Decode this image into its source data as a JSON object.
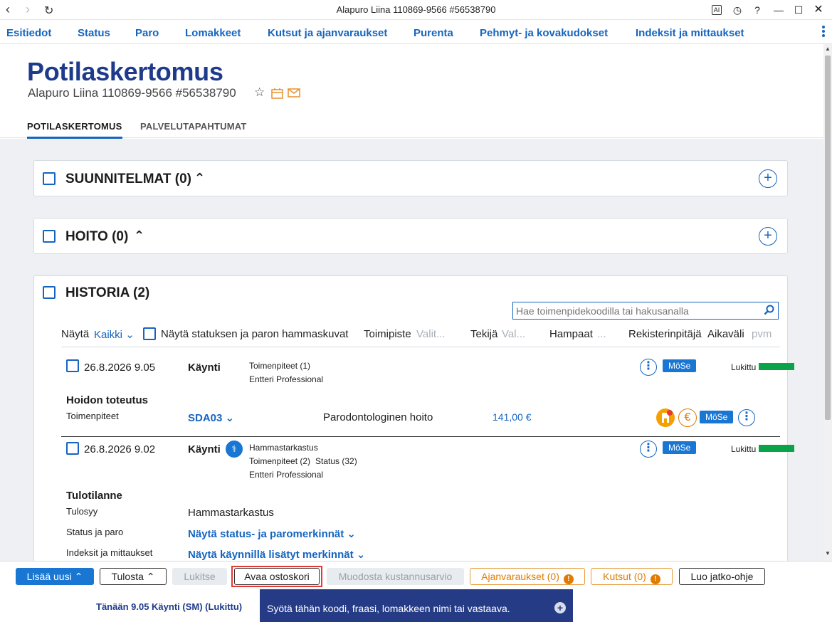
{
  "window": {
    "title": "Alapuro Liina 110869-9566 #56538790",
    "controls": [
      "AI",
      "history-icon",
      "?",
      "minimize",
      "maximize",
      "close"
    ]
  },
  "menu": {
    "items": [
      "Esitiedot",
      "Status",
      "Paro",
      "Lomakkeet",
      "Kutsut ja ajanvaraukset",
      "Purenta",
      "Pehmyt- ja kovakudokset",
      "Indeksit ja mittaukset"
    ]
  },
  "header": {
    "title": "Potilaskertomus",
    "patient": "Alapuro Liina 110869-9566 #56538790",
    "tabs": [
      "POTILASKERTOMUS",
      "PALVELUTAPAHTUMAT"
    ]
  },
  "panels": {
    "suunnitelmat": "SUUNNITELMAT (0)",
    "hoito": "HOITO (0)",
    "historia": "HISTORIA (2)"
  },
  "historia": {
    "search_placeholder": "Hae toimenpidekoodilla tai hakusanalla",
    "filters": {
      "show_label": "Näytä",
      "show_value": "Kaikki",
      "status_checkbox": "Näytä statuksen ja paron hammaskuvat",
      "toimipiste_label": "Toimipiste",
      "toimipiste_value": "Valit...",
      "tekija_label": "Tekijä",
      "tekija_value": "Val...",
      "hampaat_label": "Hampaat",
      "hampaat_value": "...",
      "rekisterinpitaja_label": "Rekisterinpitäjä",
      "aikavali_label": "Aikaväli",
      "aikavali_value": "pvm"
    },
    "entries": [
      {
        "date": "26.8.2026 9.05",
        "type": "Käynti",
        "detail1": "Toimenpiteet (1)",
        "detail2": "Entteri Professional",
        "badge": "MöSe",
        "lock": "Lukittu",
        "section_title": "Hoidon toteutus",
        "row_label": "Toimenpiteet",
        "code": "SDA03",
        "description": "Parodontologinen hoito",
        "price": "141,00 €",
        "row_badge": "MöSe"
      },
      {
        "date": "26.8.2026 9.02",
        "type": "Käynti",
        "detail0": "Hammastarkastus",
        "detail1a": "Toimenpiteet (2)",
        "detail1b": "Status (32)",
        "detail2": "Entteri Professional",
        "badge": "MöSe",
        "lock": "Lukittu",
        "section_title": "Tulotilanne",
        "rows": [
          {
            "label": "Tulosyy",
            "value": "Hammastarkastus"
          },
          {
            "label": "Status ja paro",
            "value": "Näytä status- ja paromerkinnät"
          },
          {
            "label": "Indeksit ja mittaukset",
            "value": "Näytä käynnillä lisätyt merkinnät"
          }
        ]
      }
    ]
  },
  "toolbar": {
    "add_new": "Lisää uusi",
    "print": "Tulosta",
    "lock": "Lukitse",
    "open_cart": "Avaa ostoskori",
    "cost_estimate": "Muodosta kustannusarvio",
    "appointments": "Ajanvaraukset (0)",
    "invitations": "Kutsut (0)",
    "followup": "Luo jatko-ohje"
  },
  "statusbar": {
    "status": "Tänään 9.05 Käynti (SM) (Lukittu)",
    "command_placeholder": "Syötä tähän koodi, fraasi, lomakkeen nimi tai vastaava."
  },
  "colors": {
    "primary": "#1565c0",
    "title": "#1e3a8a",
    "accent_orange": "#e07b00",
    "lock_green": "#0ba34a",
    "command_bar": "#253b86",
    "highlight_red": "#e53935"
  }
}
